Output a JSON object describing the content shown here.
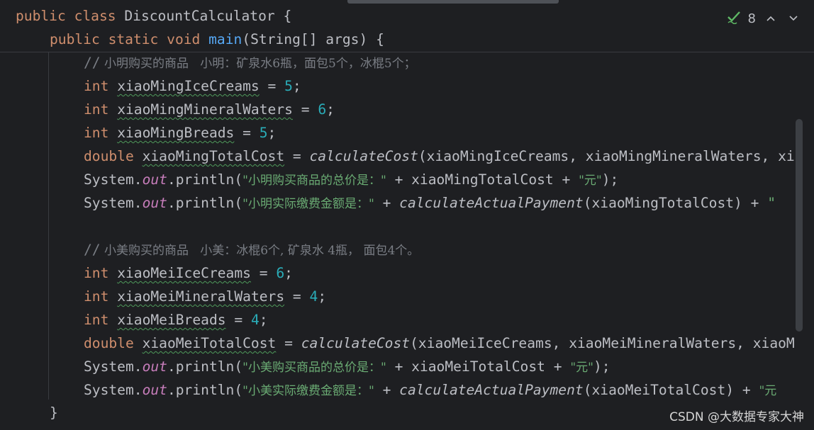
{
  "editor": {
    "lines": {
      "l1": {
        "kw_public": "public",
        "kw_class": "class",
        "class_name": "DiscountCalculator",
        "brace": "{"
      },
      "l2": {
        "kw_public": "public",
        "kw_static": "static",
        "kw_void": "void",
        "method": "main",
        "params": "(String[] args)",
        "brace": "{"
      },
      "l3": {
        "slashes": "//",
        "text": "小明购买的商品   小明：矿泉水6瓶，面包5个，冰棍5个；"
      },
      "l4": {
        "type": "int",
        "name": "xiaoMingIceCreams",
        "op": "=",
        "value": "5",
        "end": ";"
      },
      "l5": {
        "type": "int",
        "name": "xiaoMingMineralWaters",
        "op": "=",
        "value": "6",
        "end": ";"
      },
      "l6": {
        "type": "int",
        "name": "xiaoMingBreads",
        "op": "=",
        "value": "5",
        "end": ";"
      },
      "l7": {
        "type": "double",
        "name": "xiaoMingTotalCost",
        "op": "=",
        "call": "calculateCost",
        "args": "(xiaoMingIceCreams, xiaoMingMineralWaters, xi"
      },
      "l8": {
        "cls": "System.",
        "field": "out",
        "method": ".println(",
        "str": "\"小明购买商品的总价是：\"",
        "mid": " + xiaoMingTotalCost + ",
        "str2": "\"元\"",
        "end": ");"
      },
      "l9": {
        "cls": "System.",
        "field": "out",
        "method": ".println(",
        "str": "\"小明实际缴费金额是：\"",
        "mid": " + ",
        "call": "calculateActualPayment",
        "args": "(xiaoMingTotalCost) + ",
        "str2": "\""
      },
      "l11": {
        "slashes": "//",
        "text": "小美购买的商品   小美：冰棍6个, 矿泉水 4瓶， 面包4个。"
      },
      "l12": {
        "type": "int",
        "name": "xiaoMeiIceCreams",
        "op": "=",
        "value": "6",
        "end": ";"
      },
      "l13": {
        "type": "int",
        "name": "xiaoMeiMineralWaters",
        "op": "=",
        "value": "4",
        "end": ";"
      },
      "l14": {
        "type": "int",
        "name": "xiaoMeiBreads",
        "op": "=",
        "value": "4",
        "end": ";"
      },
      "l15": {
        "type": "double",
        "name": "xiaoMeiTotalCost",
        "op": "=",
        "call": "calculateCost",
        "args": "(xiaoMeiIceCreams, xiaoMeiMineralWaters, xiaoM"
      },
      "l16": {
        "cls": "System.",
        "field": "out",
        "method": ".println(",
        "str": "\"小美购买商品的总价是：\"",
        "mid": " + xiaoMeiTotalCost + ",
        "str2": "\"元\"",
        "end": ");"
      },
      "l17": {
        "cls": "System.",
        "field": "out",
        "method": ".println(",
        "str": "\"小美实际缴费金额是：\"",
        "mid": " + ",
        "call": "calculateActualPayment",
        "args": "(xiaoMeiTotalCost) + ",
        "str2": "\"元"
      },
      "l18": {
        "brace": "}"
      }
    }
  },
  "inspection": {
    "count": "8",
    "icon": "check-icon",
    "colors": {
      "ok": "#5fb865"
    }
  },
  "watermark": "CSDN @大数据专家大神",
  "colors": {
    "background": "#1e1f22",
    "keyword": "#cf8e6d",
    "method": "#56a8f5",
    "number": "#2aacb8",
    "string": "#6aab73",
    "field": "#c77dbb",
    "comment": "#7a7e85",
    "text": "#bcbec4"
  }
}
